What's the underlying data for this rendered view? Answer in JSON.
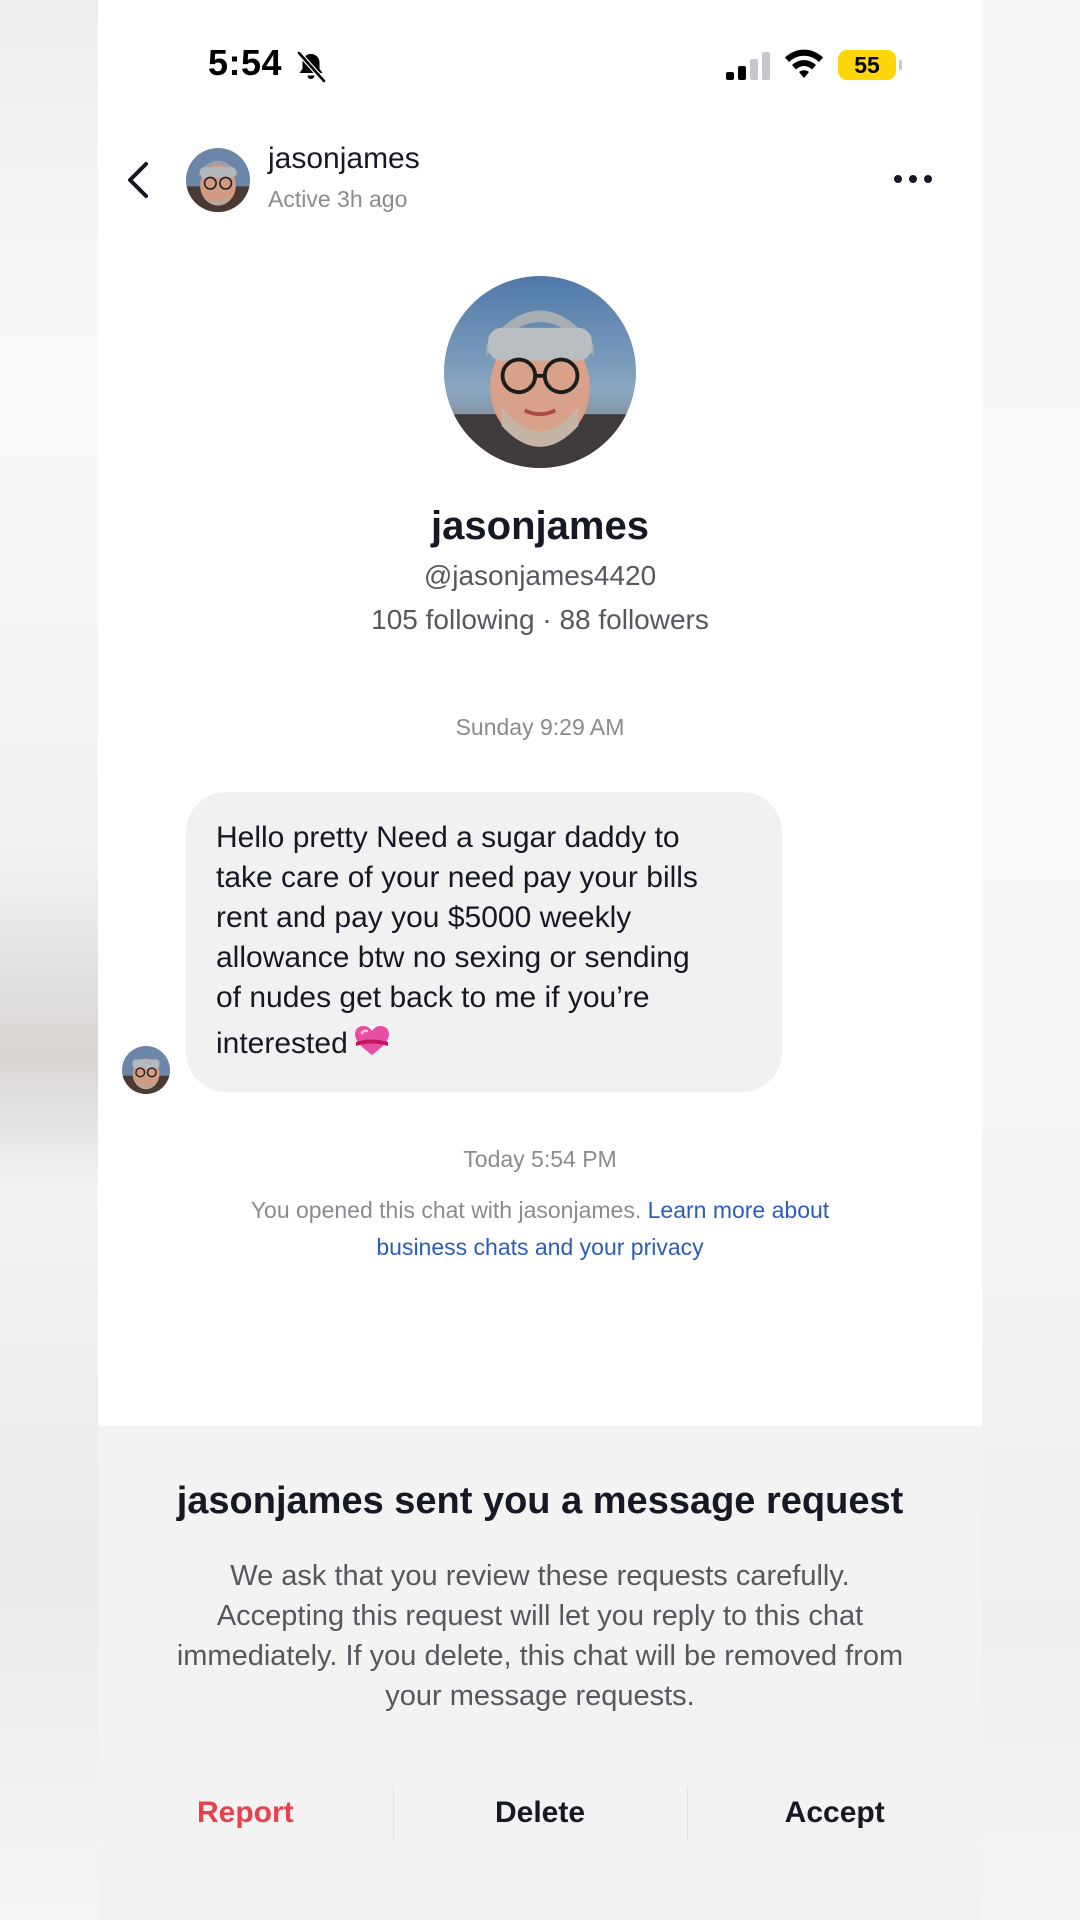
{
  "status_bar": {
    "time": "5:54",
    "battery": "55",
    "icons": [
      "bell-slash-icon",
      "cellular-signal-icon",
      "wifi-icon",
      "battery-icon"
    ]
  },
  "header": {
    "back_icon": "chevron-left-icon",
    "name": "jasonjames",
    "active_status": "Active 3h ago",
    "more_icon": "ellipsis-icon"
  },
  "profile": {
    "name": "jasonjames",
    "handle": "@jasonjames4420",
    "stats": "105 following · 88 followers"
  },
  "messages": [
    {
      "timestamp": "Sunday 9:29 AM",
      "lines": [
        "Hello pretty Need a sugar daddy to",
        "take care of your need pay your bills",
        "rent and pay you $5000 weekly",
        "allowance btw no sexing or sending",
        "of nudes get back to me if you’re",
        "interested"
      ],
      "emoji": "heart-with-ribbon-icon"
    }
  ],
  "chat_notice": {
    "timestamp": "Today 5:54 PM",
    "text": "You opened this chat with jasonjames. ",
    "link_line1": "Learn more about",
    "link_line2": "business chats and your privacy"
  },
  "request_sheet": {
    "title": "jasonjames sent you a message request",
    "body_lines": [
      "We ask that you review these requests carefully.",
      "Accepting this request will let you reply to this chat",
      "immediately. If you delete, this chat will be removed from",
      "your message requests."
    ],
    "report_label": "Report",
    "delete_label": "Delete",
    "accept_label": "Accept"
  },
  "colors": {
    "report": "#e8404c",
    "link": "#2b5db8",
    "battery": "#ffd60a",
    "bubble": "#f1f1f2"
  }
}
